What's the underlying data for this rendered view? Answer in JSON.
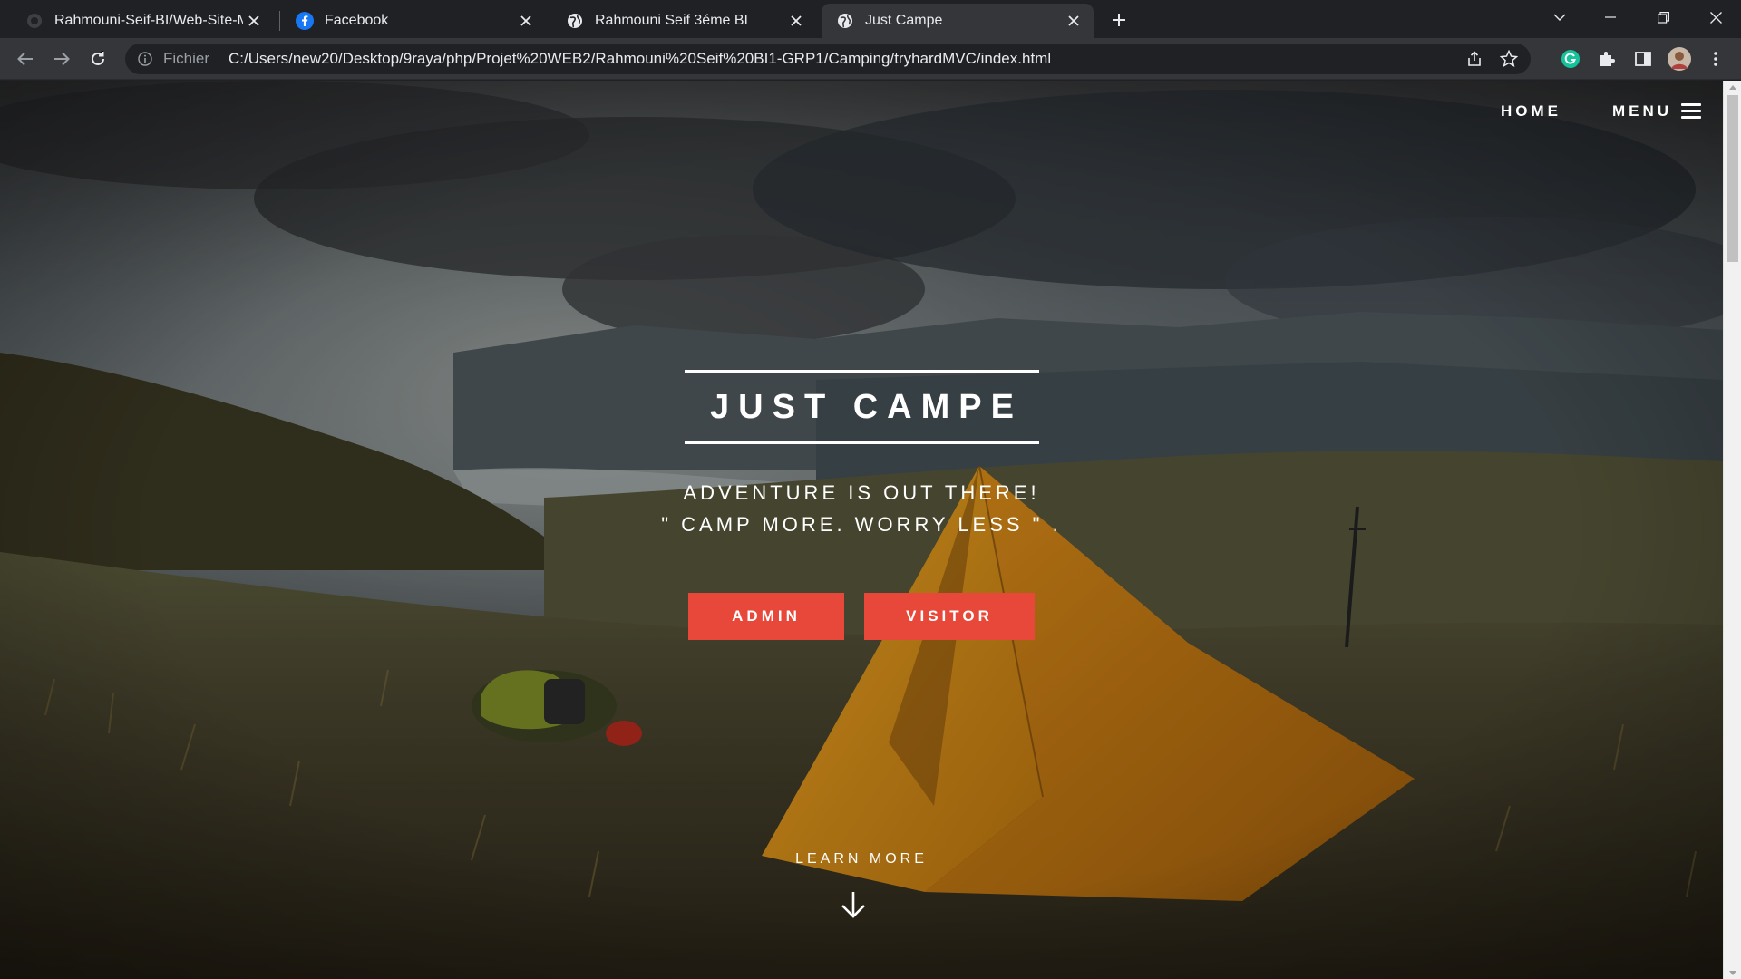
{
  "browser": {
    "tabs": [
      {
        "title": "Rahmouni-Seif-BI/Web-Site-MVC",
        "icon": "github-icon",
        "active": false
      },
      {
        "title": "Facebook",
        "icon": "facebook-icon",
        "active": false
      },
      {
        "title": "Rahmouni Seif 3éme BI",
        "icon": "globe-icon",
        "active": false
      },
      {
        "title": "Just Campe",
        "icon": "globe-icon",
        "active": true
      }
    ],
    "address": {
      "scheme_label": "Fichier",
      "url": "C:/Users/new20/Desktop/9raya/php/Projet%20WEB2/Rahmouni%20Seif%20BI1-GRP1/Camping/tryhardMVC/index.html"
    }
  },
  "page": {
    "nav": {
      "home_label": "HOME",
      "menu_label": "MENU"
    },
    "hero": {
      "title": "JUST CAMPE",
      "tagline_line1": "ADVENTURE IS OUT THERE!",
      "tagline_line2": "\" CAMP MORE. WORRY LESS \" .",
      "admin_label": "ADMIN",
      "visitor_label": "VISITOR",
      "learn_more_label": "LEARN MORE"
    }
  },
  "colors": {
    "accent_button": "#e8483a",
    "tab_strip": "#202124",
    "toolbar": "#35363a",
    "tent": "#d9901a"
  }
}
